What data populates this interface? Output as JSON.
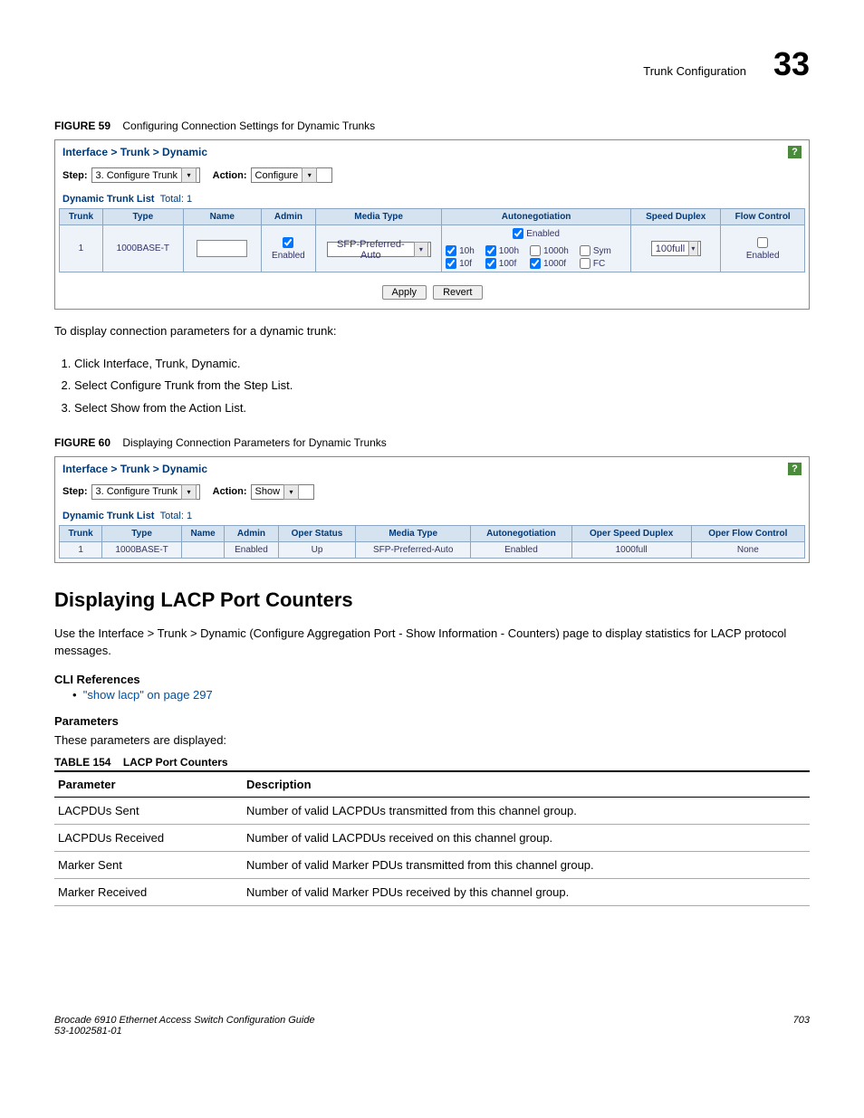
{
  "header": {
    "section": "Trunk Configuration",
    "chapter": "33"
  },
  "figure59": {
    "label": "FIGURE 59",
    "title": "Configuring Connection Settings for Dynamic Trunks",
    "breadcrumb": "Interface > Trunk > Dynamic",
    "step_label": "Step:",
    "step_value": "3. Configure Trunk",
    "action_label": "Action:",
    "action_value": "Configure",
    "list_title": "Dynamic Trunk List",
    "total_label": "Total: 1",
    "headers": {
      "trunk": "Trunk",
      "type": "Type",
      "name": "Name",
      "admin": "Admin",
      "media": "Media Type",
      "auton": "Autonegotiation",
      "speed": "Speed Duplex",
      "flow": "Flow Control"
    },
    "row": {
      "trunk": "1",
      "type": "1000BASE-T",
      "name": "",
      "admin_label": "Enabled",
      "media_value": "SFP-Preferred-Auto",
      "auton_enabled": "Enabled",
      "opts": {
        "h10": "10h",
        "h100": "100h",
        "h1000": "1000h",
        "sym": "Sym",
        "f10": "10f",
        "f100": "100f",
        "f1000": "1000f",
        "fc": "FC"
      },
      "speed_value": "100full",
      "flow_label": "Enabled"
    },
    "apply": "Apply",
    "revert": "Revert"
  },
  "intro_text": "To display connection parameters for a dynamic trunk:",
  "steps": [
    "Click Interface, Trunk, Dynamic.",
    "Select Configure Trunk from the Step List.",
    "Select Show from the Action List."
  ],
  "figure60": {
    "label": "FIGURE 60",
    "title": "Displaying Connection Parameters for Dynamic Trunks",
    "breadcrumb": "Interface > Trunk > Dynamic",
    "step_label": "Step:",
    "step_value": "3. Configure Trunk",
    "action_label": "Action:",
    "action_value": "Show",
    "list_title": "Dynamic Trunk List",
    "total_label": "Total: 1",
    "headers": {
      "trunk": "Trunk",
      "type": "Type",
      "name": "Name",
      "admin": "Admin",
      "oper": "Oper Status",
      "media": "Media Type",
      "auton": "Autonegotiation",
      "ospeed": "Oper Speed Duplex",
      "oflow": "Oper Flow Control"
    },
    "row": {
      "trunk": "1",
      "type": "1000BASE-T",
      "name": "",
      "admin": "Enabled",
      "oper": "Up",
      "media": "SFP-Preferred-Auto",
      "auton": "Enabled",
      "ospeed": "1000full",
      "oflow": "None"
    }
  },
  "lacp": {
    "heading": "Displaying LACP Port Counters",
    "intro": "Use the Interface > Trunk > Dynamic (Configure Aggregation Port - Show Information - Counters) page to display statistics for LACP protocol messages.",
    "cli_ref_head": "CLI References",
    "cli_link": "\"show lacp\" on page 297",
    "params_head": "Parameters",
    "params_intro": "These parameters are displayed:",
    "table_label": "TABLE 154",
    "table_title": "LACP Port Counters",
    "col_param": "Parameter",
    "col_desc": "Description",
    "rows": [
      {
        "p": "LACPDUs Sent",
        "d": "Number of valid LACPDUs transmitted from this channel group."
      },
      {
        "p": "LACPDUs Received",
        "d": "Number of valid LACPDUs received on this channel group."
      },
      {
        "p": "Marker Sent",
        "d": "Number of valid Marker PDUs transmitted from this channel group."
      },
      {
        "p": "Marker Received",
        "d": "Number of valid Marker PDUs received by this channel group."
      }
    ]
  },
  "footer": {
    "left1": "Brocade 6910 Ethernet Access Switch Configuration Guide",
    "left2": "53-1002581-01",
    "page": "703"
  }
}
